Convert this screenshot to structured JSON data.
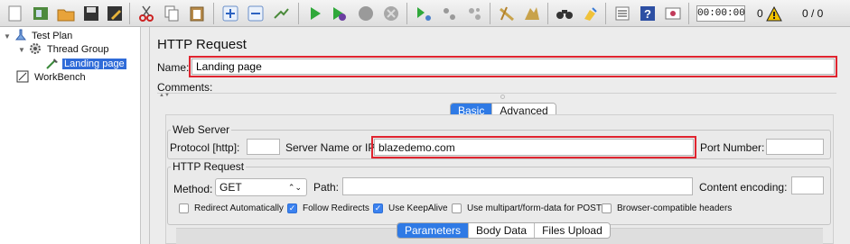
{
  "toolbar": {
    "icons": [
      "new-icon",
      "templates-icon",
      "open-icon",
      "save-icon",
      "save-as-icon",
      "cut-icon",
      "copy-icon",
      "paste-icon",
      "expand-icon",
      "collapse-icon",
      "toggle-icon",
      "start-icon",
      "start-no-pauses-icon",
      "stop-icon",
      "shutdown-icon",
      "remote-start-icon",
      "remote-stop-icon",
      "remote-shutdown-icon",
      "clear-icon",
      "clear-all-icon",
      "search-icon",
      "reset-search-icon",
      "function-helper-icon",
      "help-icon",
      "options-icon"
    ],
    "timer": "00:00:00",
    "warnings": "0",
    "threads": "0 / 0",
    "warning_color": "#f2c200"
  },
  "tree": {
    "items": [
      {
        "label": "Test Plan"
      },
      {
        "label": "Thread Group"
      },
      {
        "label": "Landing page"
      },
      {
        "label": "WorkBench"
      }
    ]
  },
  "panel": {
    "title": "HTTP Request",
    "name_label": "Name:",
    "name_value": "Landing page",
    "comments_label": "Comments:",
    "tabs": [
      "Basic",
      "Advanced"
    ],
    "web_server": {
      "legend": "Web Server",
      "protocol_label": "Protocol [http]:",
      "protocol_value": "",
      "server_label": "Server Name or IP:",
      "server_value": "blazedemo.com",
      "port_label": "Port Number:",
      "port_value": ""
    },
    "http_request": {
      "legend": "HTTP Request",
      "method_label": "Method:",
      "method_value": "GET",
      "path_label": "Path:",
      "path_value": "",
      "encoding_label": "Content encoding:",
      "encoding_value": ""
    },
    "options": [
      {
        "label": "Redirect Automatically",
        "checked": false
      },
      {
        "label": "Follow Redirects",
        "checked": true
      },
      {
        "label": "Use KeepAlive",
        "checked": true
      },
      {
        "label": "Use multipart/form-data for POST",
        "checked": false
      },
      {
        "label": "Browser-compatible headers",
        "checked": false
      }
    ],
    "bottom_tabs": [
      "Parameters",
      "Body Data",
      "Files Upload"
    ],
    "accent": "#2f7ae5",
    "highlight": "#e0242f"
  }
}
